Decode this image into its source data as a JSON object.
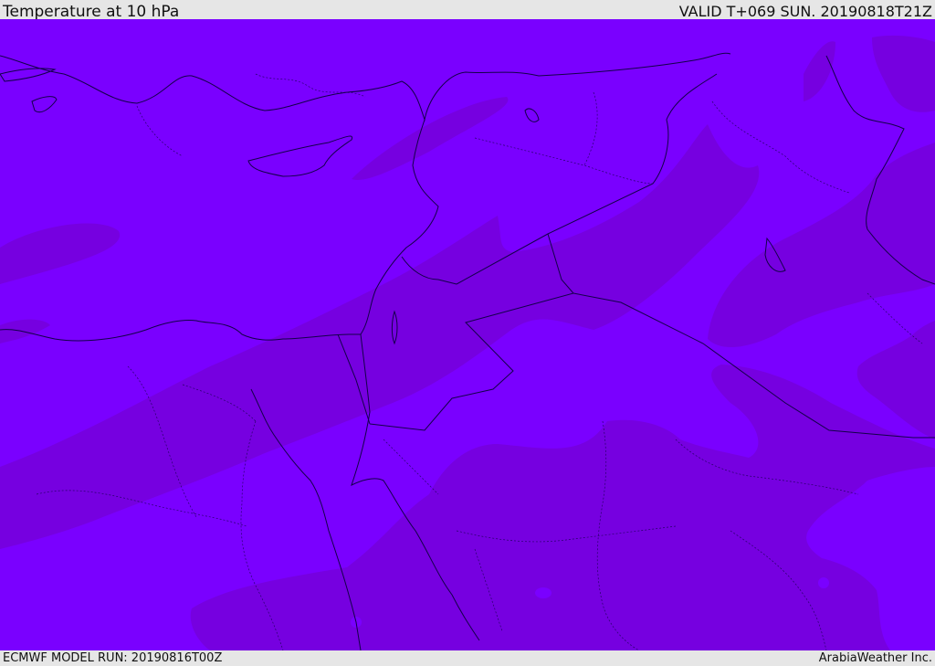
{
  "header": {
    "title": "Temperature at 10 hPa",
    "valid": "VALID T+069 SUN. 20190818T21Z"
  },
  "footer": {
    "model_run": "ECMWF MODEL RUN: 20190816T00Z",
    "credit": "ArabiaWeather Inc."
  },
  "colors": {
    "field_light": "#7a00ff",
    "field_dark": "#7600e0",
    "coast": "#14004a",
    "background": "#e6e6e6"
  }
}
